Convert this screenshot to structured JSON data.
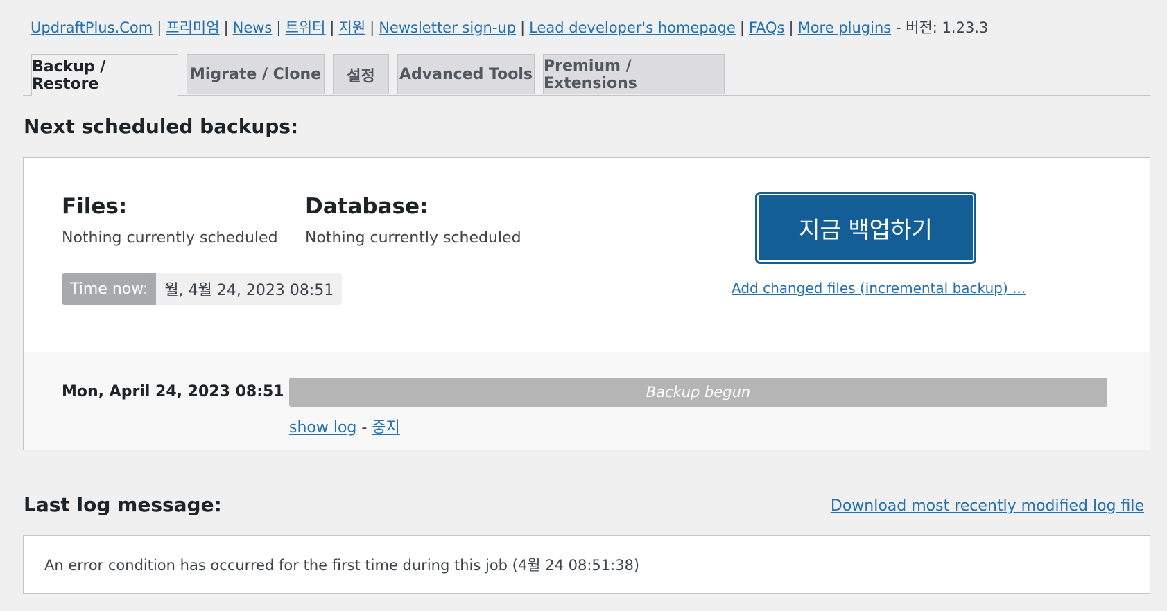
{
  "top_links": {
    "items": [
      "UpdraftPlus.Com",
      "프리미엄",
      "News",
      "트위터",
      "지원",
      "Newsletter sign-up",
      "Lead developer's homepage",
      "FAQs",
      "More plugins"
    ],
    "version_text": "- 버전: 1.23.3"
  },
  "tabs": [
    "Backup / Restore",
    "Migrate / Clone",
    "설정",
    "Advanced Tools",
    "Premium / Extensions"
  ],
  "scheduled": {
    "heading": "Next scheduled backups:",
    "files_label": "Files:",
    "files_value": "Nothing currently scheduled",
    "db_label": "Database:",
    "db_value": "Nothing currently scheduled",
    "time_now_label": "Time now:",
    "time_now_value": "월, 4월 24, 2023 08:51",
    "backup_now_button": "지금 백업하기",
    "incremental_link": "Add changed files (incremental backup) ..."
  },
  "job": {
    "date": "Mon, April 24, 2023 08:51",
    "status": "Backup begun",
    "progress_fraction": 1.0,
    "show_log": "show log",
    "link_separator": "-",
    "stop": "중지"
  },
  "log": {
    "heading": "Last log message:",
    "download_link": "Download most recently modified log file",
    "message": "An error condition has occurred for the first time during this job (4월 24 08:51:38)"
  }
}
